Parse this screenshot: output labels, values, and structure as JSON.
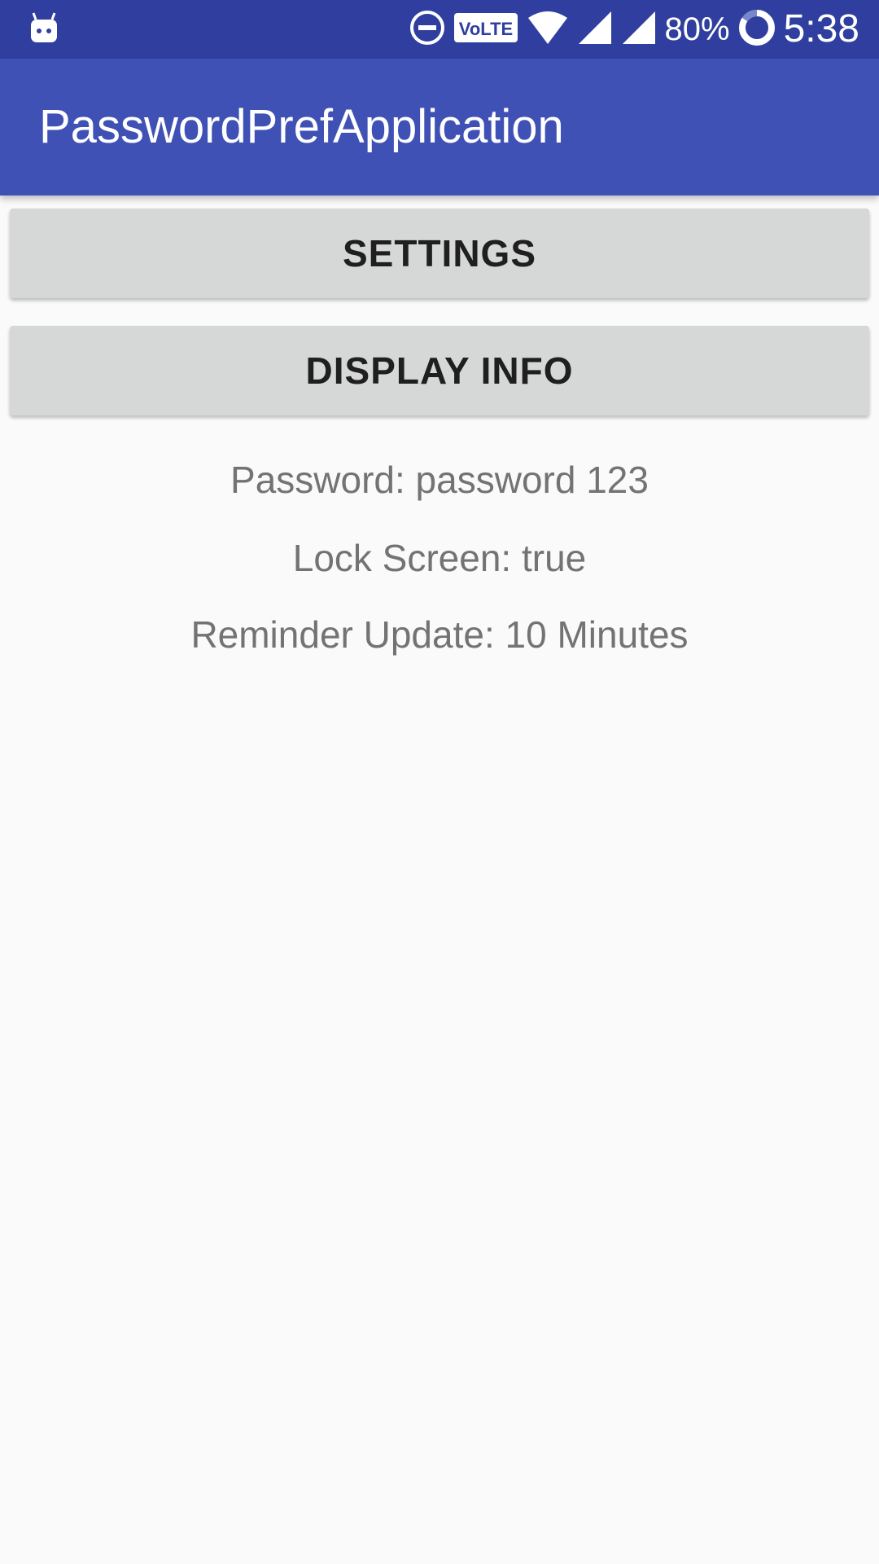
{
  "status_bar": {
    "battery_percent": "80%",
    "time": "5:38",
    "volte_label": "VoLTE",
    "icons": [
      "android-notification-icon",
      "do-not-disturb-icon",
      "volte-icon",
      "wifi-icon",
      "signal-icon",
      "signal-icon-2",
      "battery-saver-icon"
    ],
    "background_color": "#303f9f"
  },
  "app_bar": {
    "title": "PasswordPrefApplication",
    "background_color": "#3f51b5"
  },
  "buttons": {
    "settings_label": "SETTINGS",
    "display_info_label": "DISPLAY INFO"
  },
  "info": {
    "password": "Password: password 123",
    "lock_screen": "Lock Screen: true",
    "reminder_update": "Reminder Update: 10 Minutes"
  }
}
